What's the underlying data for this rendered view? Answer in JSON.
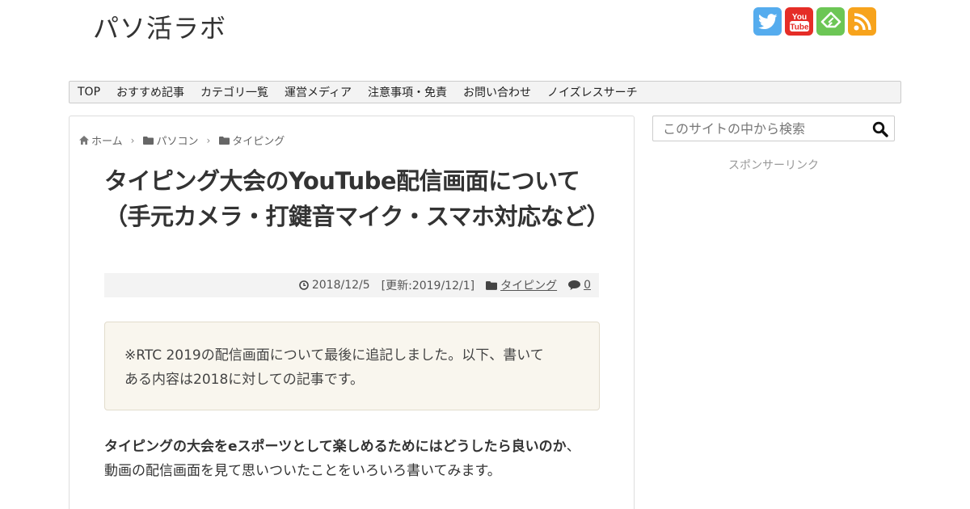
{
  "site": {
    "title": "パソ活ラボ"
  },
  "social": [
    {
      "name": "twitter-icon",
      "color": "#55acee"
    },
    {
      "name": "youtube-icon",
      "color": "#e52d27",
      "text_top": "You",
      "text_bottom": "Tube"
    },
    {
      "name": "feedly-icon",
      "color": "#6cc655"
    },
    {
      "name": "rss-icon",
      "color": "#f7a31c"
    }
  ],
  "nav": {
    "items": [
      "TOP",
      "おすすめ記事",
      "カテゴリ一覧",
      "運営メディア",
      "注意事項・免責",
      "お問い合わせ",
      "ノイズレスサーチ"
    ]
  },
  "breadcrumb": {
    "home": "ホーム",
    "cat1": "パソコン",
    "cat2": "タイピング"
  },
  "article": {
    "title": "タイピング大会のYouTube配信画面について（手元カメラ・打鍵音マイク・スマホ対応など）",
    "date": "2018/12/5",
    "updated": "[更新:2019/12/1]",
    "category": "タイピング",
    "comments": "0",
    "notice_line1": "※RTC 2019の配信画面について最後に追記しました。以下、書いて",
    "notice_line2": "ある内容は2018に対しての記事です。",
    "intro_bold": "タイピングの大会をeスポーツとして楽しめるためにはどうしたら良いのか",
    "intro_rest": "、動画の配信画面を見て思いついたことをいろいろ書いてみます。"
  },
  "sidebar": {
    "search_placeholder": "このサイトの中から検索",
    "sponsor": "スポンサーリンク"
  }
}
